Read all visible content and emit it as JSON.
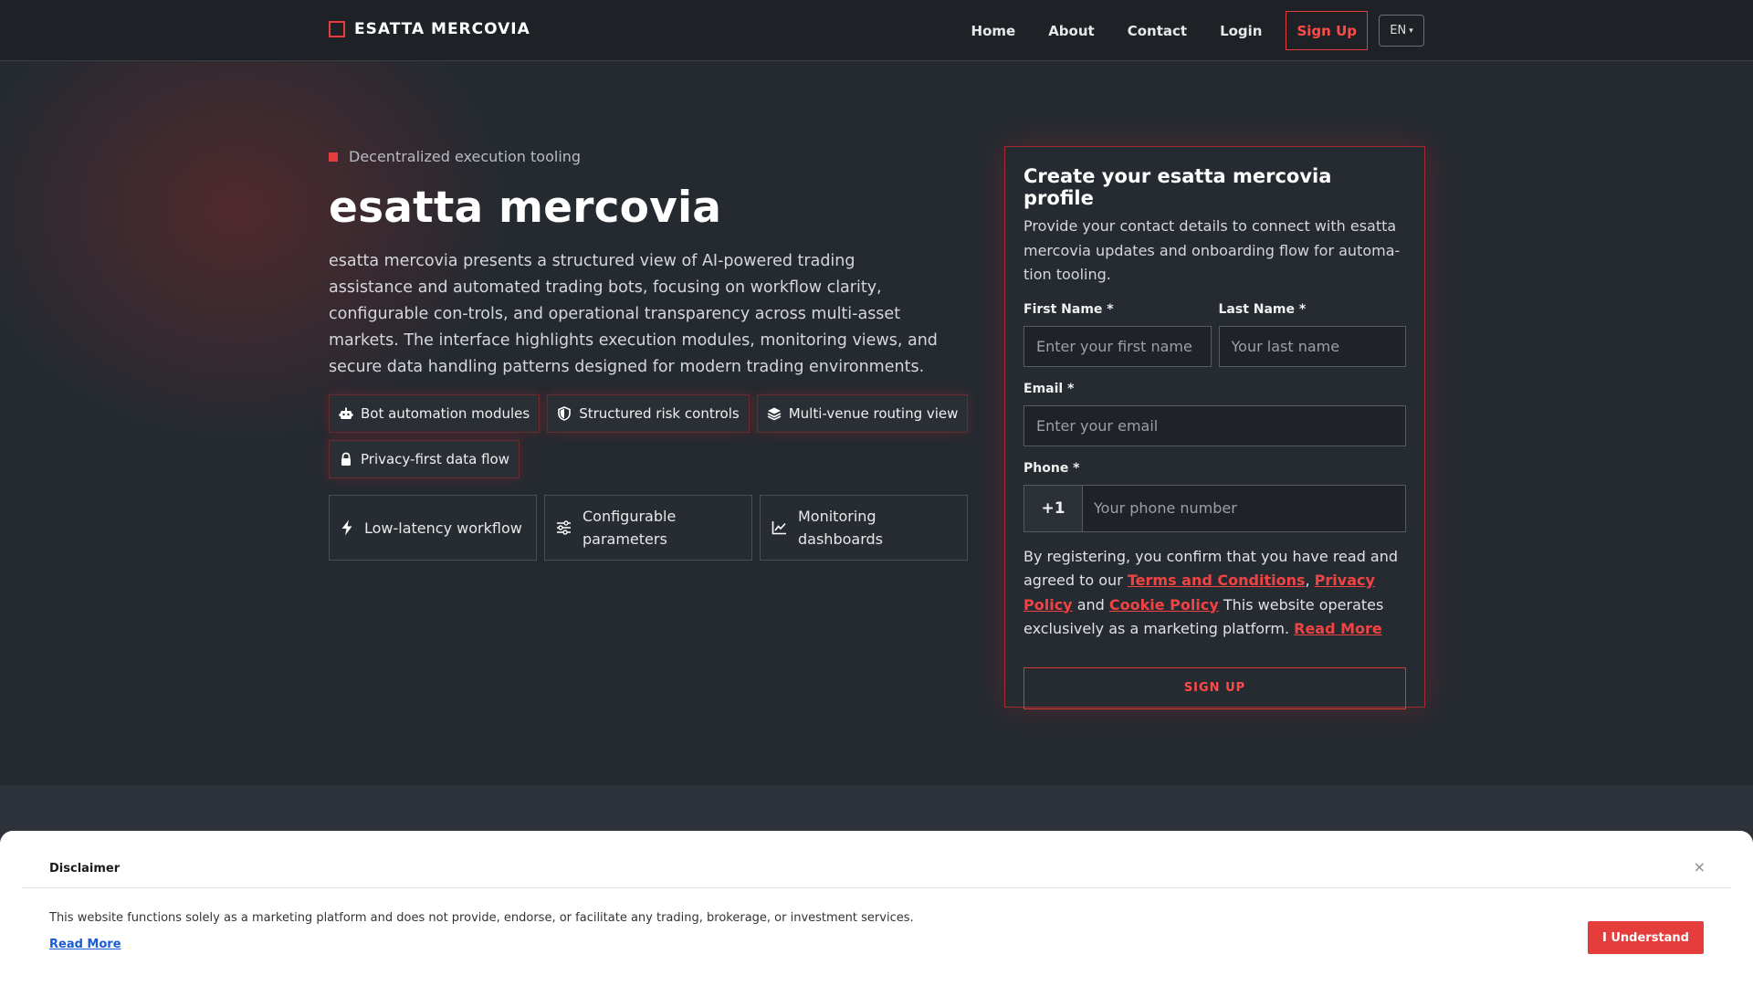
{
  "header": {
    "brand": "ESATTA MERCOVIA",
    "nav": [
      "Home",
      "About",
      "Contact",
      "Login"
    ],
    "signup": "Sign Up",
    "lang": "EN"
  },
  "hero": {
    "eyebrow": "Decentralized execution tooling",
    "title": "esatta mercovia",
    "intro": "esatta mercovia presents a structured view of AI-powered trading assistance and automated trading bots, focusing on workflow clarity, configurable con-trols, and operational transparency across multi-asset markets. The interface highlights execution modules, monitoring views, and secure data handling patterns designed for modern trading environments.",
    "chips": [
      {
        "icon": "robot-icon",
        "label": "Bot automation modules"
      },
      {
        "icon": "shield-icon",
        "label": "Structured risk controls"
      },
      {
        "icon": "layers-icon",
        "label": "Multi-venue routing view"
      },
      {
        "icon": "lock-icon",
        "label": "Privacy-first data flow"
      }
    ],
    "cards": [
      {
        "icon": "bolt-icon",
        "label": "Low-latency workflow"
      },
      {
        "icon": "sliders-icon",
        "label": "Configurable parameters"
      },
      {
        "icon": "chart-line-icon",
        "label": "Monitoring dashboards"
      }
    ]
  },
  "form": {
    "title": "Create your esatta mercovia profile",
    "subtitle": "Provide your contact details to connect with esatta mercovia updates and onboarding flow for automa-tion tooling.",
    "first_name_label": "First Name *",
    "first_name_placeholder": "Enter your first name",
    "last_name_label": "Last Name *",
    "last_name_placeholder": "Your last name",
    "email_label": "Email *",
    "email_placeholder": "Enter your email",
    "phone_label": "Phone *",
    "phone_code": "+1",
    "phone_placeholder": "Your phone number",
    "legal_prefix": "By registering, you confirm that you have read and agreed to our",
    "terms": "Terms and Conditions",
    "comma": ",",
    "privacy": "Privacy Policy",
    "and": "and",
    "cookie": "Cookie Policy",
    "legal_suffix": "This website operates exclusively as a marketing platform.",
    "read_more": "Read More",
    "submit": "SIGN UP"
  },
  "disclaimer": {
    "title": "Disclaimer",
    "close": "×",
    "text": "This website functions solely as a marketing platform and does not provide, endorse, or facilitate any trading, brokerage, or investment services.",
    "read_more": "Read More",
    "button": "I Understand"
  },
  "colors": {
    "accent": "#e53c3c",
    "background": "#252a31",
    "link_blue": "#1a5bd6"
  }
}
